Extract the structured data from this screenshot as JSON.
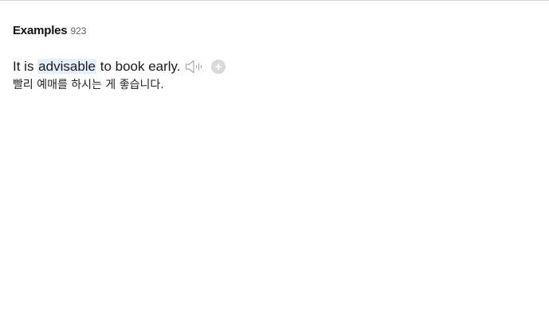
{
  "examples": {
    "title": "Examples",
    "count": "923",
    "items": [
      {
        "before": "It is ",
        "highlight": "advisable",
        "after": " to book early.",
        "translation": "빨리 예매를 하시는 게 좋습니다.",
        "audio_icon": "speaker-icon",
        "add_icon": "add-circle-icon"
      }
    ]
  },
  "colors": {
    "highlight_bg": "#e6f0fb",
    "icon_gray": "#b5b5b5",
    "add_bg": "#d9d9d9"
  }
}
